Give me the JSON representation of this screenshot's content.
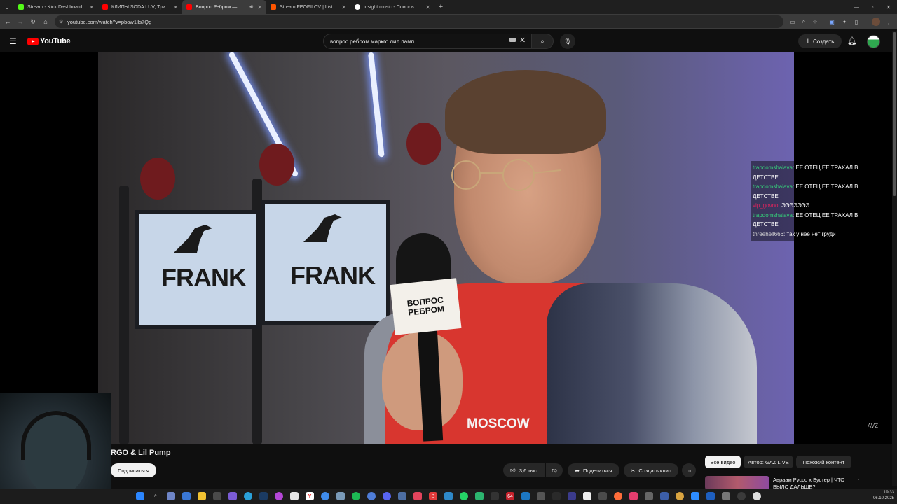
{
  "browser": {
    "tabs": [
      {
        "title": "Stream - Kick Dashboard",
        "color": "#53fc18",
        "active": false
      },
      {
        "title": "КЛИПЫ SODA LUV, Три дня дождя",
        "color": "#ff0000",
        "active": false
      },
      {
        "title": "Вопрос Ребром — MARG",
        "color": "#ff0000",
        "active": true
      },
      {
        "title": "Stream FEOFILOV | Listen to m",
        "color": "#ff5500",
        "active": false
      },
      {
        "title": "insight music - Поиск в Google",
        "color": "#ffffff",
        "active": false
      }
    ],
    "url": "youtube.com/watch?v=pbow1lls7Qg"
  },
  "youtube": {
    "logo_text": "YouTube",
    "search_query": "вопрос ребром маркго лил памп",
    "create_label": "Создать"
  },
  "video": {
    "frank_text": "FRANK",
    "mic_flag_line1": "ВОПРОС",
    "mic_flag_line2": "РЕБРОМ",
    "shirt_text": "MOSCOW",
    "watermark": "AVZ"
  },
  "chat": [
    {
      "user": "trapdomshalava",
      "text": "ЕЕ ОТЕЦ ЕЕ ТРАХАЛ В ДЕТСТВЕ",
      "color": "#35d17a"
    },
    {
      "user": "trapdomshalava",
      "text": "ЕЕ ОТЕЦ ЕЕ ТРАХАЛ В ДЕТСТВЕ",
      "color": "#35d17a"
    },
    {
      "user": "vip_govno",
      "text": "ЭЭЭЭЭЭЭ",
      "color": "#e0245e"
    },
    {
      "user": "trapdomshalava",
      "text": "ЕЕ ОТЕЦ ЕЕ ТРАХАЛ В ДЕТСТВЕ",
      "color": "#35d17a"
    },
    {
      "user": "threehell666",
      "text": "так у неё нет груди",
      "color": "#d8d8d8"
    }
  ],
  "below": {
    "title": "RGO & Lil Pump",
    "subscribe_label": "Подписаться",
    "likes": "3,6 тыс.",
    "share_label": "Поделиться",
    "clip_label": "Создать клип",
    "chips": [
      "Все видео",
      "Автор: GAZ LIVE",
      "Похожий контент"
    ],
    "rec_title": "Авраам Руссо x Бустер | ЧТО БЫЛО ДАЛЬШЕ?"
  },
  "taskbar": {
    "time": "19:33",
    "date": "06.10.2025"
  }
}
